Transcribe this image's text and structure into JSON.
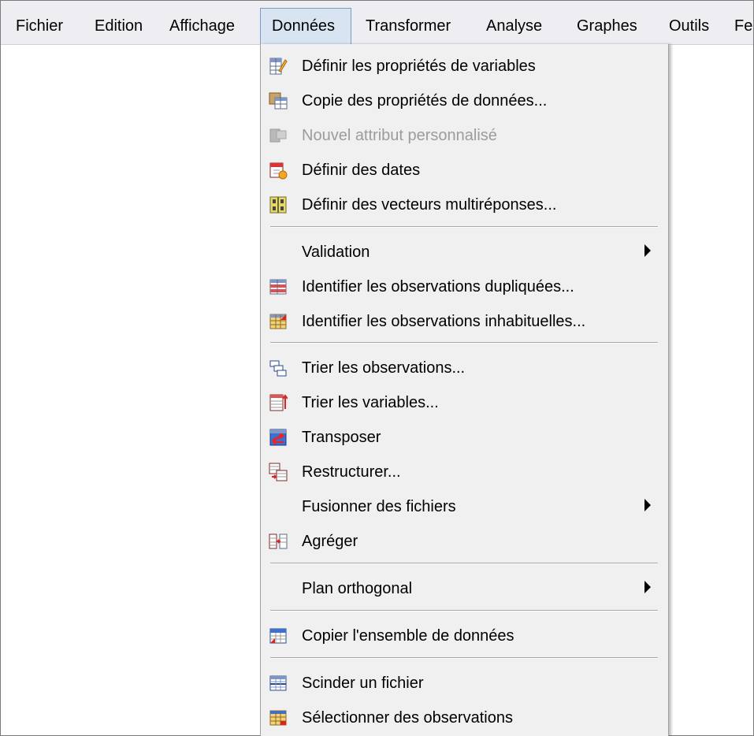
{
  "menubar": {
    "items": [
      "Fichier",
      "Edition",
      "Affichage",
      "Données",
      "Transformer",
      "Analyse",
      "Graphes",
      "Outils",
      "Fe"
    ]
  },
  "menu": {
    "items": [
      {
        "label": "Définir les propriétés de variables",
        "icon": "define-variable-properties-icon",
        "enabled": true
      },
      {
        "label": "Copie des propriétés de données...",
        "icon": "copy-data-properties-icon",
        "enabled": true
      },
      {
        "label": "Nouvel attribut personnalisé",
        "icon": "new-custom-attribute-icon",
        "enabled": false
      },
      {
        "label": "Définir des dates",
        "icon": "define-dates-icon",
        "enabled": true
      },
      {
        "label": "Définir des vecteurs multiréponses...",
        "icon": "multiple-response-sets-icon",
        "enabled": true
      },
      {
        "label": "Validation",
        "icon": "",
        "enabled": true,
        "submenu": true
      },
      {
        "label": "Identifier les observations dupliquées...",
        "icon": "duplicate-cases-icon",
        "enabled": true
      },
      {
        "label": "Identifier les observations inhabituelles...",
        "icon": "unusual-cases-icon",
        "enabled": true
      },
      {
        "label": "Trier les observations...",
        "icon": "sort-cases-icon",
        "enabled": true
      },
      {
        "label": "Trier les variables...",
        "icon": "sort-variables-icon",
        "enabled": true
      },
      {
        "label": "Transposer",
        "icon": "transpose-icon",
        "enabled": true
      },
      {
        "label": "Restructurer...",
        "icon": "restructure-icon",
        "enabled": true
      },
      {
        "label": "Fusionner des fichiers",
        "icon": "",
        "enabled": true,
        "submenu": true
      },
      {
        "label": "Agréger",
        "icon": "aggregate-icon",
        "enabled": true
      },
      {
        "label": "Plan orthogonal",
        "icon": "",
        "enabled": true,
        "submenu": true
      },
      {
        "label": "Copier l'ensemble de données",
        "icon": "copy-dataset-icon",
        "enabled": true
      },
      {
        "label": "Scinder un fichier",
        "icon": "split-file-icon",
        "enabled": true
      },
      {
        "label": "Sélectionner des observations",
        "icon": "select-cases-icon",
        "enabled": true
      }
    ]
  }
}
